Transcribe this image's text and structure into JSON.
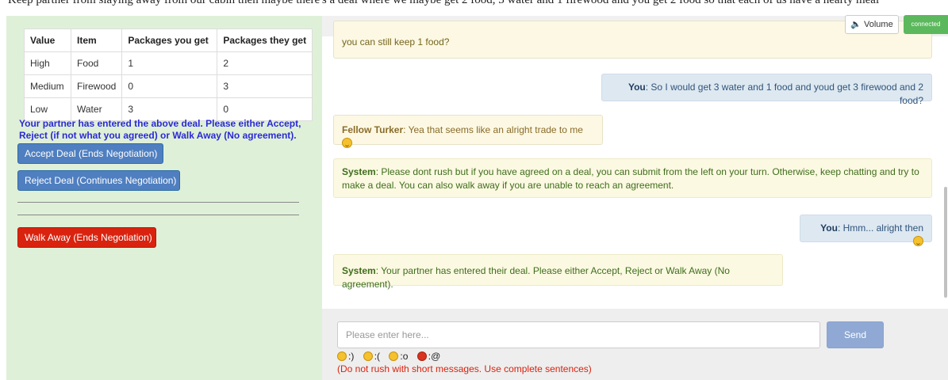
{
  "top_strip_text": "Keep partner from slaying away from our cabin then maybe there's a deal where we maybe get 2 food, 3 water and 1 firewood and you get 2 food so that each of us have a hearty meal",
  "table": {
    "headers": [
      "Value",
      "Item",
      "Packages you get",
      "Packages they get"
    ],
    "rows": [
      [
        "High",
        "Food",
        "1",
        "2"
      ],
      [
        "Medium",
        "Firewood",
        "0",
        "3"
      ],
      [
        "Low",
        "Water",
        "3",
        "0"
      ]
    ]
  },
  "partner_message": "Your partner has entered the above deal. Please either Accept, Reject (if not what you agreed) or Walk Away (No agreement).",
  "buttons": {
    "accept": "Accept Deal (Ends Negotiation)",
    "reject": "Reject Deal (Continues Negotiation)",
    "walk": "Walk Away (Ends Negotiation)",
    "volume": "🔈 Volume",
    "send": "Send"
  },
  "status": {
    "connected": "connected"
  },
  "messages": [
    {
      "sender": "",
      "text": "you can still keep 1 food?"
    },
    {
      "sender": "You",
      "text": ": So I would get 3 water and 1 food and youd get 3 firewood and 2 food?"
    },
    {
      "sender": "Fellow Turker",
      "text": ": Yea that seems like an alright trade to me "
    },
    {
      "sender": "System",
      "text": ": Please dont rush but if you have agreed on a deal, you can submit from the left on your turn. Otherwise, keep chatting and try to make a deal. You can also walk away if you are unable to reach an agreement."
    },
    {
      "sender": "You",
      "text": ": Hmm... alright then "
    },
    {
      "sender": "System",
      "text": ": Your partner has entered their deal. Please either Accept, Reject or Walk Away (No agreement)."
    }
  ],
  "input": {
    "placeholder": "Please enter here..."
  },
  "emojis": [
    {
      "icon": "smile-emoji-icon",
      "code": ":)"
    },
    {
      "icon": "sad-emoji-icon",
      "code": ":("
    },
    {
      "icon": "surprised-emoji-icon",
      "code": ":o"
    },
    {
      "icon": "angry-emoji-icon",
      "code": ":@"
    }
  ],
  "warning": "(Do not rush with short messages. Use complete sentences)",
  "colors": {
    "left_panel": "#dff0d8",
    "accept": "#4f7fc0",
    "walk": "#d9230f",
    "connected": "#5cb85c",
    "partner_msg": "#2a2ad6"
  }
}
